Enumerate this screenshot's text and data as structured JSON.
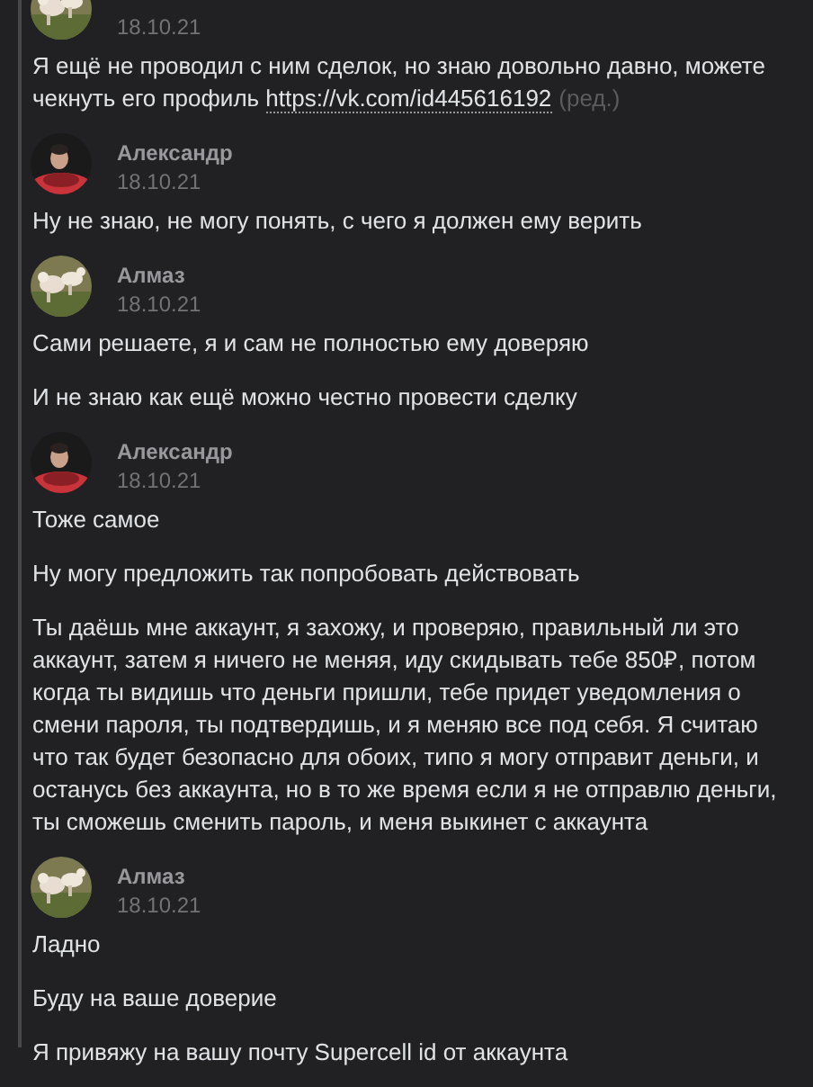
{
  "messages": [
    {
      "date": "18.10.21",
      "avatar": {
        "kind": "picture"
      },
      "texts": [
        {
          "text": "Я ещё не проводил с ним сделок, но знаю довольно давно, можете чекнуть его профиль ",
          "link": "https://vk.com/id445616192",
          "edited": "(ред.)"
        }
      ]
    },
    {
      "author": "Александр",
      "date": "18.10.21",
      "avatar": {
        "kind": "picture"
      },
      "texts": [
        {
          "text": "Ну не знаю, не могу понять, с чего я должен ему верить"
        }
      ]
    },
    {
      "author": "Алмаз",
      "date": "18.10.21",
      "avatar": {
        "kind": "picture"
      },
      "texts": [
        {
          "text": "Сами решаете, я и сам не полностью ему доверяю"
        },
        {
          "text": "И не знаю как ещё можно честно провести сделку"
        }
      ]
    },
    {
      "author": "Александр",
      "date": "18.10.21",
      "avatar": {
        "kind": "picture"
      },
      "texts": [
        {
          "text": "Тоже самое"
        },
        {
          "text": "Ну могу предложить так попробовать действовать"
        },
        {
          "text": "Ты даёшь мне аккаунт, я захожу, и проверяю, правильный ли это аккаунт, затем я ничего не меняя, иду скидывать тебе 850₽, потом когда ты видишь что деньги пришли, тебе придет уведомления о смени пароля, ты подтвердишь, и я меняю все под себя. Я считаю что так будет безопасно для обоих, типо я могу отправит деньги, и останусь без аккаунта, но в то же время если я не отправлю деньги, ты сможешь сменить пароль, и меня выкинет с аккаунта"
        }
      ]
    },
    {
      "author": "Алмаз",
      "date": "18.10.21",
      "avatar": {
        "kind": "picture"
      },
      "texts": [
        {
          "text": "Ладно"
        },
        {
          "text": "Буду на ваше доверие"
        },
        {
          "text": "Я привяжу на вашу почту Supercell id от аккаунта"
        }
      ]
    }
  ]
}
